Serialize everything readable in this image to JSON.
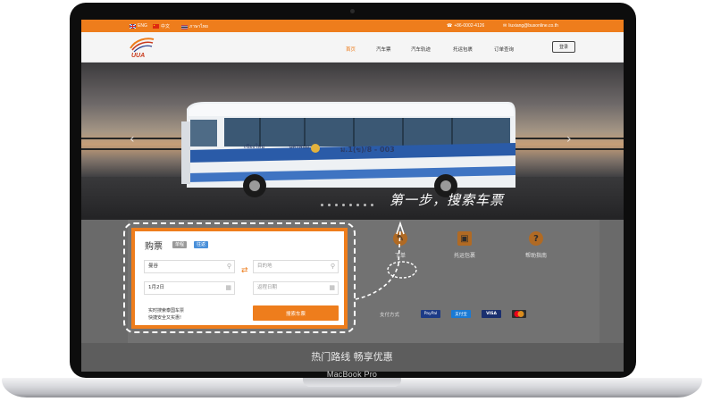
{
  "device": {
    "label": "MacBook Pro"
  },
  "topbar": {
    "languages": [
      {
        "label": "ENG",
        "flag": "uk-flag-icon"
      },
      {
        "label": "中文",
        "flag": "cn-flag-icon"
      },
      {
        "label": "ภาษาไทย",
        "flag": "th-flag-icon"
      }
    ],
    "phone": "+86-0002-4126",
    "email": "liuxiang@busonline.co.th",
    "bg_color": "#ee7d1c"
  },
  "nav": {
    "logo_text": "UUA",
    "items": [
      {
        "label": "首页",
        "active": true
      },
      {
        "label": "汽车票",
        "active": false
      },
      {
        "label": "汽车轨迹",
        "active": false
      },
      {
        "label": "托运包裹",
        "active": false
      },
      {
        "label": "订单查询",
        "active": false
      }
    ],
    "login_label": "登录"
  },
  "hero": {
    "bus_route_text": "ม.1(ข)/8 - 003",
    "bus_dest_left": "เชียงใหม่",
    "bus_dest_right": "นครพนม",
    "slide_count": 8
  },
  "annotation": {
    "text": "第一步，搜索车票"
  },
  "booking": {
    "title": "购票",
    "tabs": [
      {
        "label": "单程",
        "color": "#9a9a9a"
      },
      {
        "label": "往返",
        "color": "#4a90d9"
      }
    ],
    "from_value": "曼谷",
    "to_placeholder": "目的地",
    "date_value": "1月2日",
    "return_placeholder": "返程日期",
    "tip_line1": "实时搜索泰国车票",
    "tip_line2": "快捷安全又实惠!",
    "search_label": "搜索车票",
    "accent_color": "#ee7d1c"
  },
  "features": [
    {
      "label": "下单",
      "icon": "ticket-icon"
    },
    {
      "label": "托运包裹",
      "icon": "parcel-icon"
    },
    {
      "label": "帮助指南",
      "icon": "help-icon"
    }
  ],
  "payment": {
    "label": "支付方式",
    "methods": [
      "PayPal",
      "支付宝",
      "VISA",
      "MasterCard"
    ]
  },
  "promo": {
    "title": "热门路线 畅享优惠"
  }
}
